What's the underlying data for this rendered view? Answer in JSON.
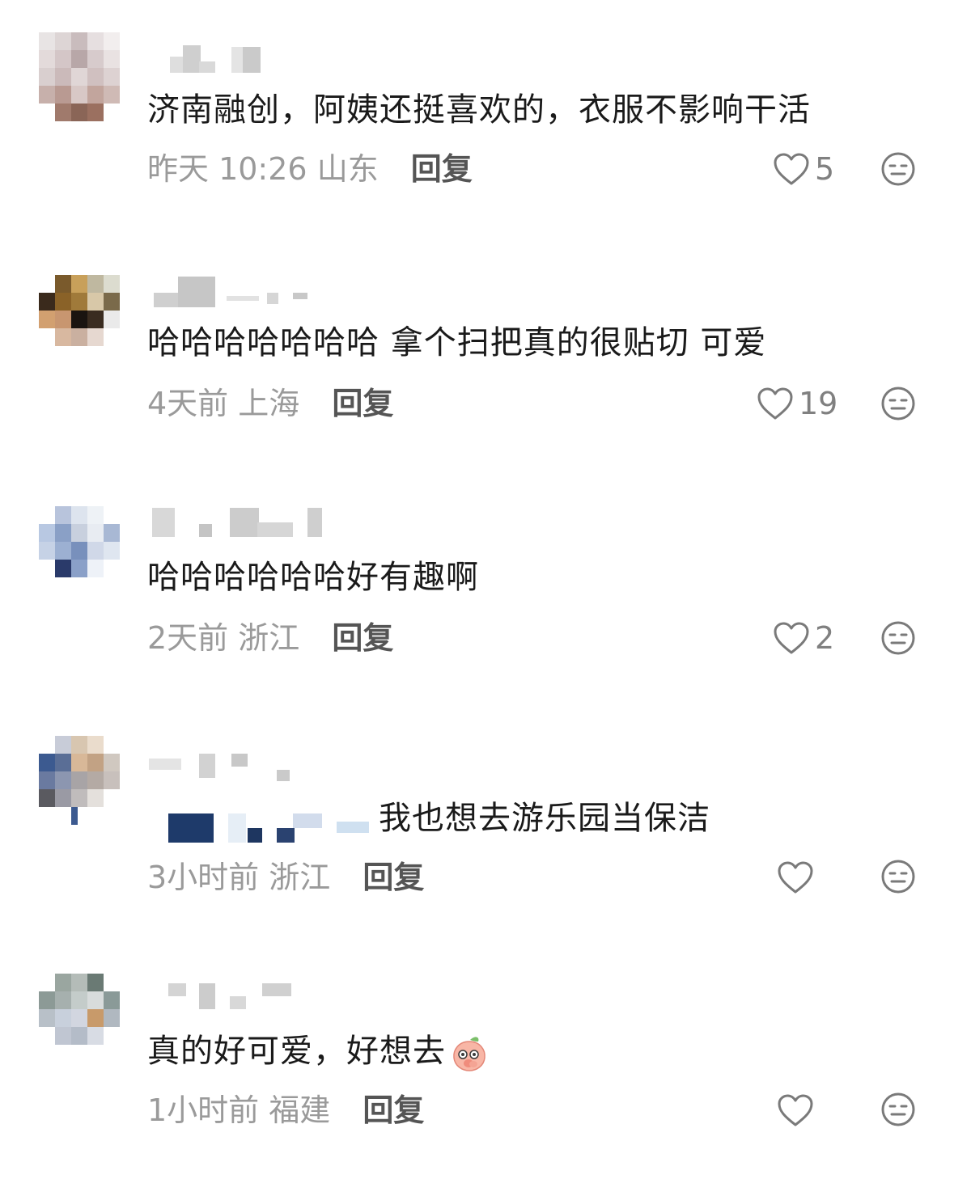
{
  "comments": [
    {
      "text": "济南融创，阿姨还挺喜欢的，衣服不影响干活",
      "time": "昨天 10:26",
      "location": "山东",
      "reply_label": "回复",
      "like_count": "5"
    },
    {
      "text": "哈哈哈哈哈哈哈 拿个扫把真的很贴切 可爱",
      "time": "4天前",
      "location": "上海",
      "reply_label": "回复",
      "like_count": "19"
    },
    {
      "text": "哈哈哈哈哈哈好有趣啊",
      "time": "2天前",
      "location": "浙江",
      "reply_label": "回复",
      "like_count": "2"
    },
    {
      "text": "我也想去游乐园当保洁",
      "time": "3小时前",
      "location": "浙江",
      "reply_label": "回复",
      "like_count": ""
    },
    {
      "text": "真的好可爱，好想去",
      "time": "1小时前",
      "location": "福建",
      "reply_label": "回复",
      "like_count": ""
    }
  ],
  "icons": {
    "like": "heart-outline-icon",
    "dislike": "neutral-face-icon",
    "emoji": "peach-emoji-icon"
  },
  "colors": {
    "text": "#1a1a1a",
    "meta": "#9a9a9a",
    "reply": "#555555",
    "icon": "#7a7a7a"
  }
}
